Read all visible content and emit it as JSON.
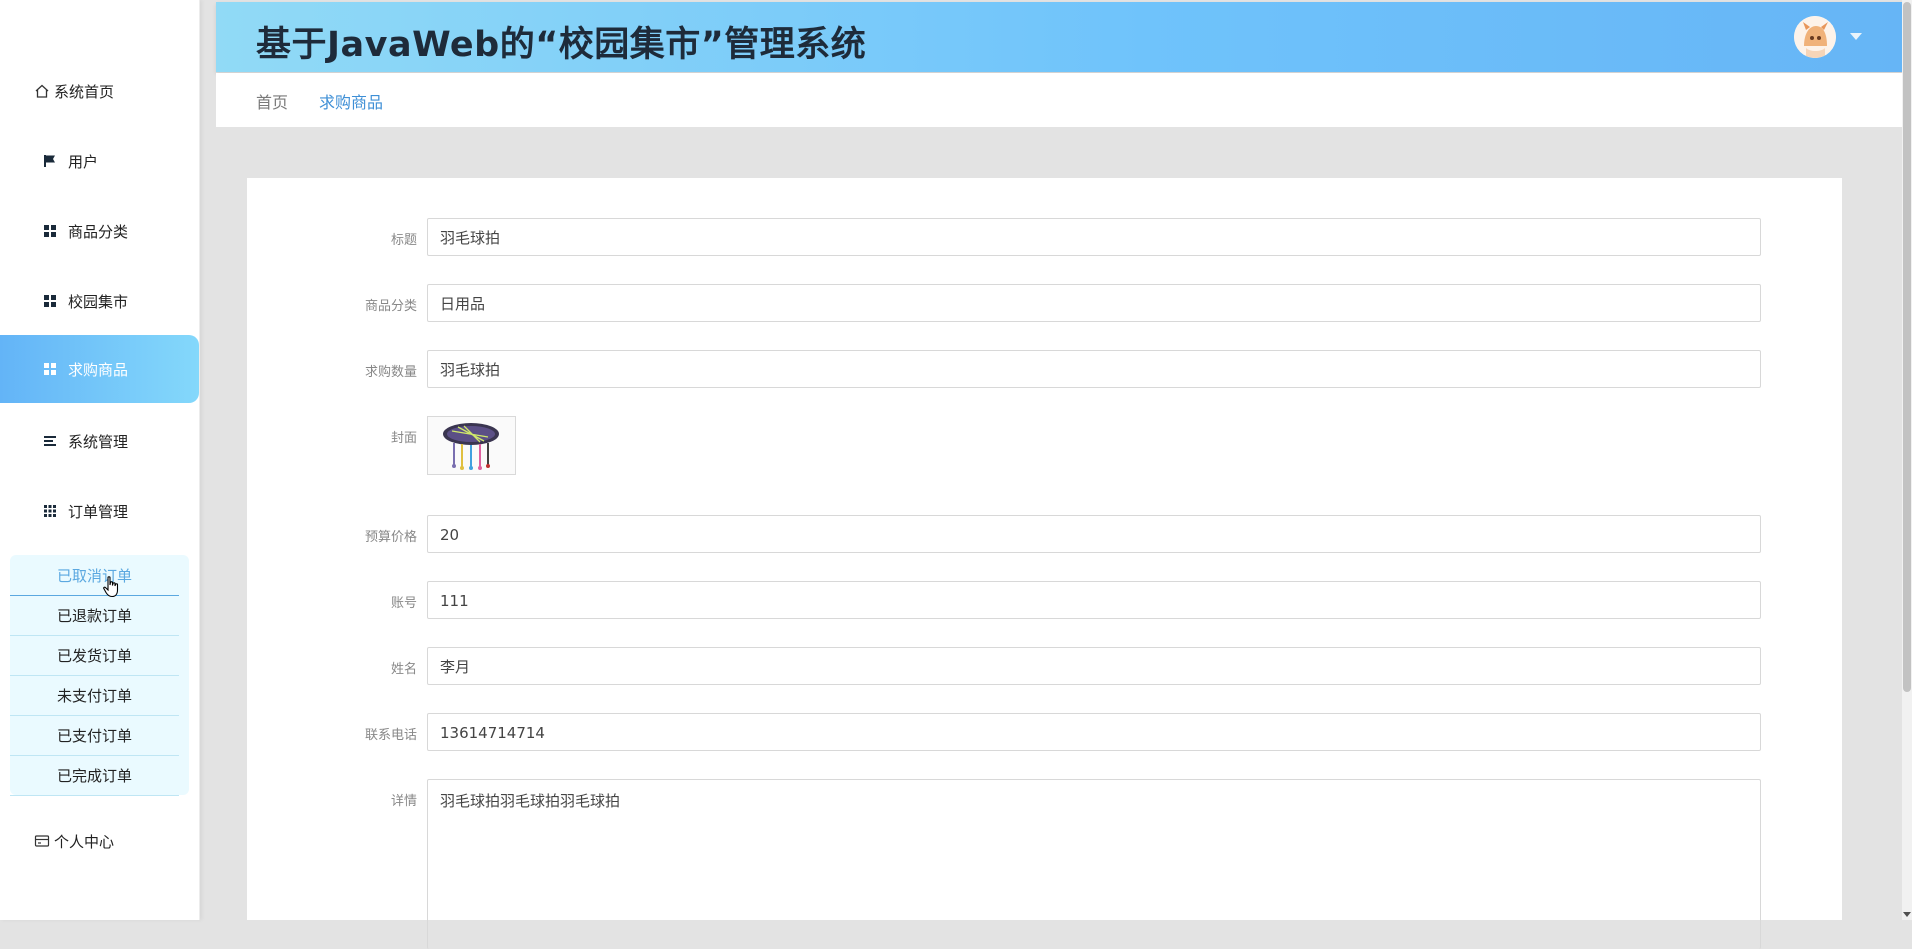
{
  "header": {
    "title": "基于JavaWeb的“校园集市”管理系统"
  },
  "breadcrumb": {
    "home": "首页",
    "current": "求购商品"
  },
  "sidebar": {
    "items": [
      {
        "label": "系统首页",
        "icon": "home-icon"
      },
      {
        "label": "用户",
        "icon": "flag-icon"
      },
      {
        "label": "商品分类",
        "icon": "grid-icon"
      },
      {
        "label": "校园集市",
        "icon": "grid-icon"
      },
      {
        "label": "求购商品",
        "icon": "grid-icon",
        "active": true
      },
      {
        "label": "系统管理",
        "icon": "list-icon"
      },
      {
        "label": "订单管理",
        "icon": "apps-icon"
      },
      {
        "label": "个人中心",
        "icon": "card-icon"
      }
    ],
    "submenu": [
      {
        "label": "已取消订单"
      },
      {
        "label": "已退款订单"
      },
      {
        "label": "已发货订单"
      },
      {
        "label": "未支付订单"
      },
      {
        "label": "已支付订单"
      },
      {
        "label": "已完成订单"
      }
    ]
  },
  "form": {
    "title_label": "标题",
    "title_value": "羽毛球拍",
    "category_label": "商品分类",
    "category_value": "日用品",
    "quantity_label": "求购数量",
    "quantity_value": "羽毛球拍",
    "cover_label": "封面",
    "budget_label": "预算价格",
    "budget_value": "20",
    "account_label": "账号",
    "account_value": "111",
    "name_label": "姓名",
    "name_value": "李月",
    "phone_label": "联系电话",
    "phone_value": "13614714714",
    "detail_label": "详情",
    "detail_value": "羽毛球拍羽毛球拍羽毛球拍"
  },
  "colors": {
    "header_gradient_start": "#91daf6",
    "header_gradient_end": "#66b5f6",
    "active_menu": "#63b4f7",
    "breadcrumb_current": "#3e8fd6"
  }
}
